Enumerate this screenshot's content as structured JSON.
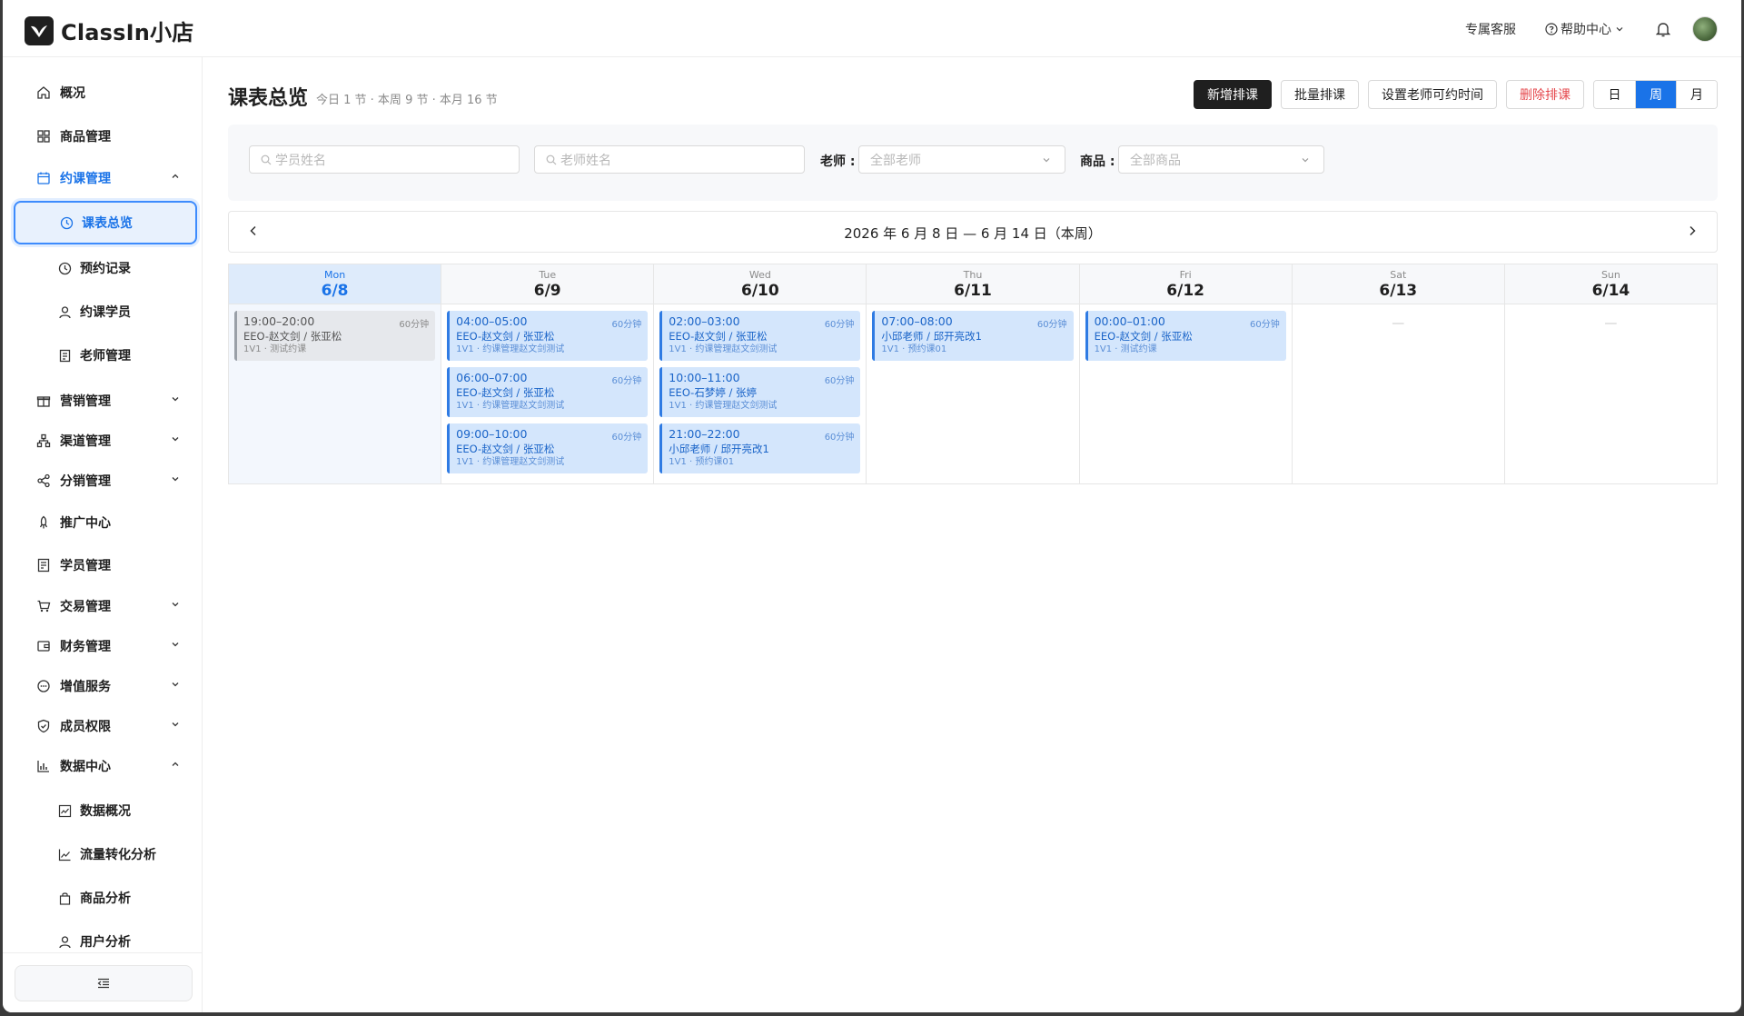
{
  "app": {
    "title": "ClassIn小店"
  },
  "topbar": {
    "support": "专属客服",
    "help": "帮助中心"
  },
  "sidebar": {
    "overview": "概况",
    "products": "商品管理",
    "booking": "约课管理",
    "booking_sub": [
      "课表总览",
      "预约记录",
      "约课学员",
      "老师管理"
    ],
    "marketing": "营销管理",
    "channel": "渠道管理",
    "distribution": "分销管理",
    "promotion": "推广中心",
    "students": "学员管理",
    "trade": "交易管理",
    "finance": "财务管理",
    "value_added": "增值服务",
    "members": "成员权限",
    "data_center": "数据中心",
    "data_sub": [
      "数据概况",
      "流量转化分析",
      "商品分析",
      "用户分析"
    ]
  },
  "header": {
    "title": "课表总览",
    "stats": "今日 1 节 · 本周 9 节 · 本月 16 节",
    "actions": {
      "new": "新增排课",
      "batch": "批量排课",
      "set_time": "设置老师可约时间",
      "delete": "删除排课"
    },
    "views": [
      "日",
      "周",
      "月"
    ],
    "active_view": "周"
  },
  "filters": {
    "student_placeholder": "学员姓名",
    "teacher_placeholder": "老师姓名",
    "teacher_label": "老师 :",
    "teacher_value": "全部老师",
    "product_label": "商品 :",
    "product_value": "全部商品"
  },
  "week": {
    "range": "2026 年 6 月 8 日 — 6 月 14 日（本周）"
  },
  "days": [
    {
      "wd": "Mon",
      "date": "6/8",
      "today": true,
      "events": [
        {
          "time": "19:00–20:00",
          "dur": "60分钟",
          "who": "EEO-赵文剑 / 张亚松",
          "note": "1V1 · 测试约课",
          "past": true
        }
      ]
    },
    {
      "wd": "Tue",
      "date": "6/9",
      "events": [
        {
          "time": "04:00–05:00",
          "dur": "60分钟",
          "who": "EEO-赵文剑 / 张亚松",
          "note": "1V1 · 约课管理赵文剑测试"
        },
        {
          "time": "06:00–07:00",
          "dur": "60分钟",
          "who": "EEO-赵文剑 / 张亚松",
          "note": "1V1 · 约课管理赵文剑测试"
        },
        {
          "time": "09:00–10:00",
          "dur": "60分钟",
          "who": "EEO-赵文剑 / 张亚松",
          "note": "1V1 · 约课管理赵文剑测试"
        }
      ]
    },
    {
      "wd": "Wed",
      "date": "6/10",
      "events": [
        {
          "time": "02:00–03:00",
          "dur": "60分钟",
          "who": "EEO-赵文剑 / 张亚松",
          "note": "1V1 · 约课管理赵文剑测试"
        },
        {
          "time": "10:00–11:00",
          "dur": "60分钟",
          "who": "EEO-石梦婷 / 张婷",
          "note": "1V1 · 约课管理赵文剑测试"
        },
        {
          "time": "21:00–22:00",
          "dur": "60分钟",
          "who": "小邱老师 / 邱开亮改1",
          "note": "1V1 · 预约课01"
        }
      ]
    },
    {
      "wd": "Thu",
      "date": "6/11",
      "events": [
        {
          "time": "07:00–08:00",
          "dur": "60分钟",
          "who": "小邱老师 / 邱开亮改1",
          "note": "1V1 · 预约课01"
        }
      ]
    },
    {
      "wd": "Fri",
      "date": "6/12",
      "events": [
        {
          "time": "00:00–01:00",
          "dur": "60分钟",
          "who": "EEO-赵文剑 / 张亚松",
          "note": "1V1 · 测试约课"
        }
      ]
    },
    {
      "wd": "Sat",
      "date": "6/13",
      "events": [],
      "empty": "—"
    },
    {
      "wd": "Sun",
      "date": "6/14",
      "events": [],
      "empty": "—"
    }
  ],
  "colors": {
    "accent": "#1a73e8",
    "primary_btn": "#1f1f1f",
    "danger": "#e5484d",
    "event_bg": "#d4e6fc"
  }
}
